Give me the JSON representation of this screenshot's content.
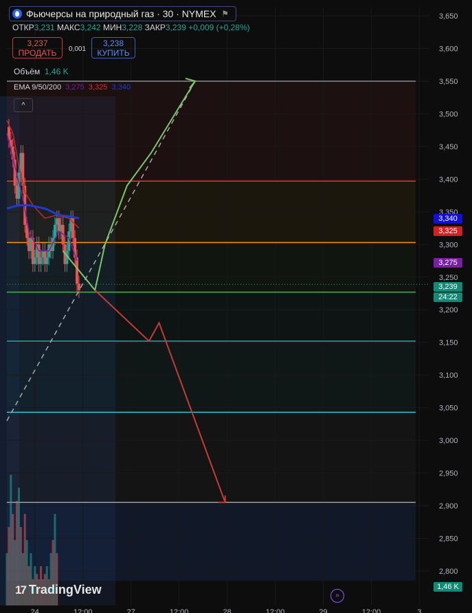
{
  "header": {
    "title": "Фьючерсы на природный газ · 30 · NYMEX",
    "ohlc": [
      {
        "label": "ОТКР",
        "value": "3,231"
      },
      {
        "label": "МАКС",
        "value": "3,242"
      },
      {
        "label": "МИН",
        "value": "3,228"
      },
      {
        "label": "ЗАКР",
        "value": "3,239"
      }
    ],
    "change": "+0,009 (+0,28%)",
    "sell_price": "3,237",
    "sell_label": "ПРОДАТЬ",
    "spread": "0,001",
    "buy_price": "3,238",
    "buy_label": "КУПИТЬ"
  },
  "volume_legend": {
    "label": "Объём",
    "value": "1,46 K"
  },
  "ema_legend": {
    "label": "EMA 9/50/200",
    "v1": "3,275",
    "v2": "3,325",
    "v3": "3,340"
  },
  "collapse_label": "^",
  "price_badges": [
    {
      "name": "ema-200-badge",
      "text": "3,340",
      "color": "#1010d8"
    },
    {
      "name": "ema-50-badge",
      "text": "3,325",
      "color": "#d61f1f"
    },
    {
      "name": "ema-9-badge",
      "text": "3,275",
      "color": "#7b1fa2"
    },
    {
      "name": "last-price-badge",
      "text": "3,239",
      "color": "#118b76"
    },
    {
      "name": "countdown-badge",
      "text": "24:22",
      "color": "#118b76"
    }
  ],
  "volume_badge": {
    "text": "1,46 K",
    "color": "#118b76"
  },
  "brand": {
    "name": "TradingView",
    "mark": "17"
  },
  "goto_icon": "go-to-realtime-icon",
  "colors": {
    "up": "#26a69a",
    "down": "#ef5350",
    "bg": "#0d0d0d"
  },
  "chart_data": {
    "type": "candlestick",
    "y_ticks": [
      "3,650",
      "3,600",
      "3,550",
      "3,500",
      "3,450",
      "3,400",
      "3,350",
      "3,300",
      "3,250",
      "3,200",
      "3,150",
      "3,100",
      "3,050",
      "3,000",
      "2,950",
      "2,900",
      "2,850",
      "2,800"
    ],
    "ylim": [
      2.785,
      3.66
    ],
    "x_ticks": [
      {
        "label": "24",
        "x": 3
      },
      {
        "label": "12:00",
        "x": 27
      },
      {
        "label": "27",
        "x": 51
      },
      {
        "label": "12:00",
        "x": 75
      },
      {
        "label": "28",
        "x": 99
      },
      {
        "label": "12:00",
        "x": 123
      },
      {
        "label": "29",
        "x": 147
      },
      {
        "label": "12:00",
        "x": 171
      },
      {
        "label": "3",
        "x": 195
      }
    ],
    "xlim": [
      -11,
      200
    ],
    "close_path": [
      [
        -11,
        3.48
      ],
      [
        -10,
        3.46
      ],
      [
        -9,
        3.45
      ],
      [
        -8,
        3.43
      ],
      [
        -7,
        3.39
      ],
      [
        -6,
        3.37
      ],
      [
        -5,
        3.41
      ],
      [
        -4,
        3.44
      ],
      [
        -3,
        3.39
      ],
      [
        -2,
        3.33
      ],
      [
        -1,
        3.31
      ],
      [
        0,
        3.29
      ],
      [
        1,
        3.31
      ],
      [
        2,
        3.27
      ],
      [
        3,
        3.28
      ],
      [
        4,
        3.3
      ],
      [
        5,
        3.27
      ],
      [
        6,
        3.28
      ],
      [
        7,
        3.29
      ],
      [
        8,
        3.27
      ],
      [
        9,
        3.28
      ],
      [
        10,
        3.3
      ],
      [
        11,
        3.29
      ],
      [
        12,
        3.31
      ],
      [
        13,
        3.33
      ],
      [
        14,
        3.34
      ],
      [
        15,
        3.32
      ],
      [
        16,
        3.33
      ],
      [
        17,
        3.3
      ],
      [
        18,
        3.27
      ],
      [
        19,
        3.29
      ],
      [
        20,
        3.32
      ],
      [
        21,
        3.34
      ],
      [
        22,
        3.31
      ],
      [
        23,
        3.28
      ],
      [
        24,
        3.24
      ],
      [
        25,
        3.23
      ]
    ],
    "ema_lines": [
      {
        "color": "#7b1fa2",
        "points": [
          [
            -11,
            3.47
          ],
          [
            -7,
            3.42
          ],
          [
            -3,
            3.37
          ],
          [
            0,
            3.32
          ],
          [
            5,
            3.29
          ],
          [
            10,
            3.29
          ],
          [
            15,
            3.32
          ],
          [
            20,
            3.31
          ],
          [
            24,
            3.275
          ]
        ]
      },
      {
        "color": "#c62828",
        "points": [
          [
            -11,
            3.49
          ],
          [
            -8,
            3.47
          ],
          [
            -5,
            3.42
          ],
          [
            -2,
            3.38
          ],
          [
            2,
            3.36
          ],
          [
            8,
            3.34
          ],
          [
            14,
            3.345
          ],
          [
            20,
            3.34
          ],
          [
            25,
            3.325
          ]
        ]
      },
      {
        "color": "#1e3ad8",
        "points": [
          [
            -11,
            3.355
          ],
          [
            -5,
            3.36
          ],
          [
            0,
            3.36
          ],
          [
            8,
            3.355
          ],
          [
            15,
            3.345
          ],
          [
            20,
            3.343
          ],
          [
            25,
            3.34
          ]
        ]
      }
    ],
    "horizontal_lines": [
      {
        "price": 3.55,
        "color": "#8a8a8a"
      },
      {
        "price": 3.397,
        "color": "#e53935"
      },
      {
        "price": 3.303,
        "color": "#ff9800"
      },
      {
        "price": 3.227,
        "color": "#4caf50"
      },
      {
        "price": 3.152,
        "color": "#26a69a"
      },
      {
        "price": 3.043,
        "color": "#26c6da"
      },
      {
        "price": 2.905,
        "color": "#9e9e9e"
      }
    ],
    "zones": [
      {
        "from": 3.397,
        "to": 3.55,
        "color": "rgba(229,57,53,0.07)"
      },
      {
        "from": 3.303,
        "to": 3.397,
        "color": "rgba(255,193,7,0.06)"
      },
      {
        "from": 3.227,
        "to": 3.303,
        "color": "rgba(76,175,80,0.05)"
      },
      {
        "from": 3.152,
        "to": 3.227,
        "color": "rgba(38,166,154,0.05)"
      },
      {
        "from": 3.043,
        "to": 3.152,
        "color": "rgba(38,166,154,0.07)"
      },
      {
        "from": 2.905,
        "to": 3.043,
        "color": "rgba(255,255,255,0.03)"
      },
      {
        "from": 2.785,
        "to": 2.905,
        "color": "rgba(30,60,120,0.25)"
      }
    ],
    "bull_path": {
      "color": "#7cc76a",
      "points": [
        [
          17,
          3.29
        ],
        [
          33,
          3.23
        ],
        [
          38,
          3.3
        ],
        [
          49,
          3.39
        ],
        [
          61,
          3.44
        ],
        [
          83,
          3.55
        ]
      ]
    },
    "bear_path": {
      "color": "#c83a3a",
      "points": [
        [
          33,
          3.23
        ],
        [
          60,
          3.152
        ],
        [
          65,
          3.18
        ],
        [
          98,
          2.905
        ]
      ]
    },
    "dashed_trend": {
      "color": "#aaaaaa",
      "points": [
        [
          -11,
          3.03
        ],
        [
          83,
          3.55
        ]
      ]
    },
    "volume": [
      0.2,
      0.3,
      0.5,
      0.35,
      0.25,
      0.4,
      0.45,
      0.3,
      0.2,
      0.35,
      0.25,
      0.15,
      0.2,
      0.1,
      0.15,
      0.12,
      0.1,
      0.15,
      0.1,
      0.12,
      0.15,
      0.1,
      0.2,
      0.25,
      0.35,
      0.2
    ]
  }
}
